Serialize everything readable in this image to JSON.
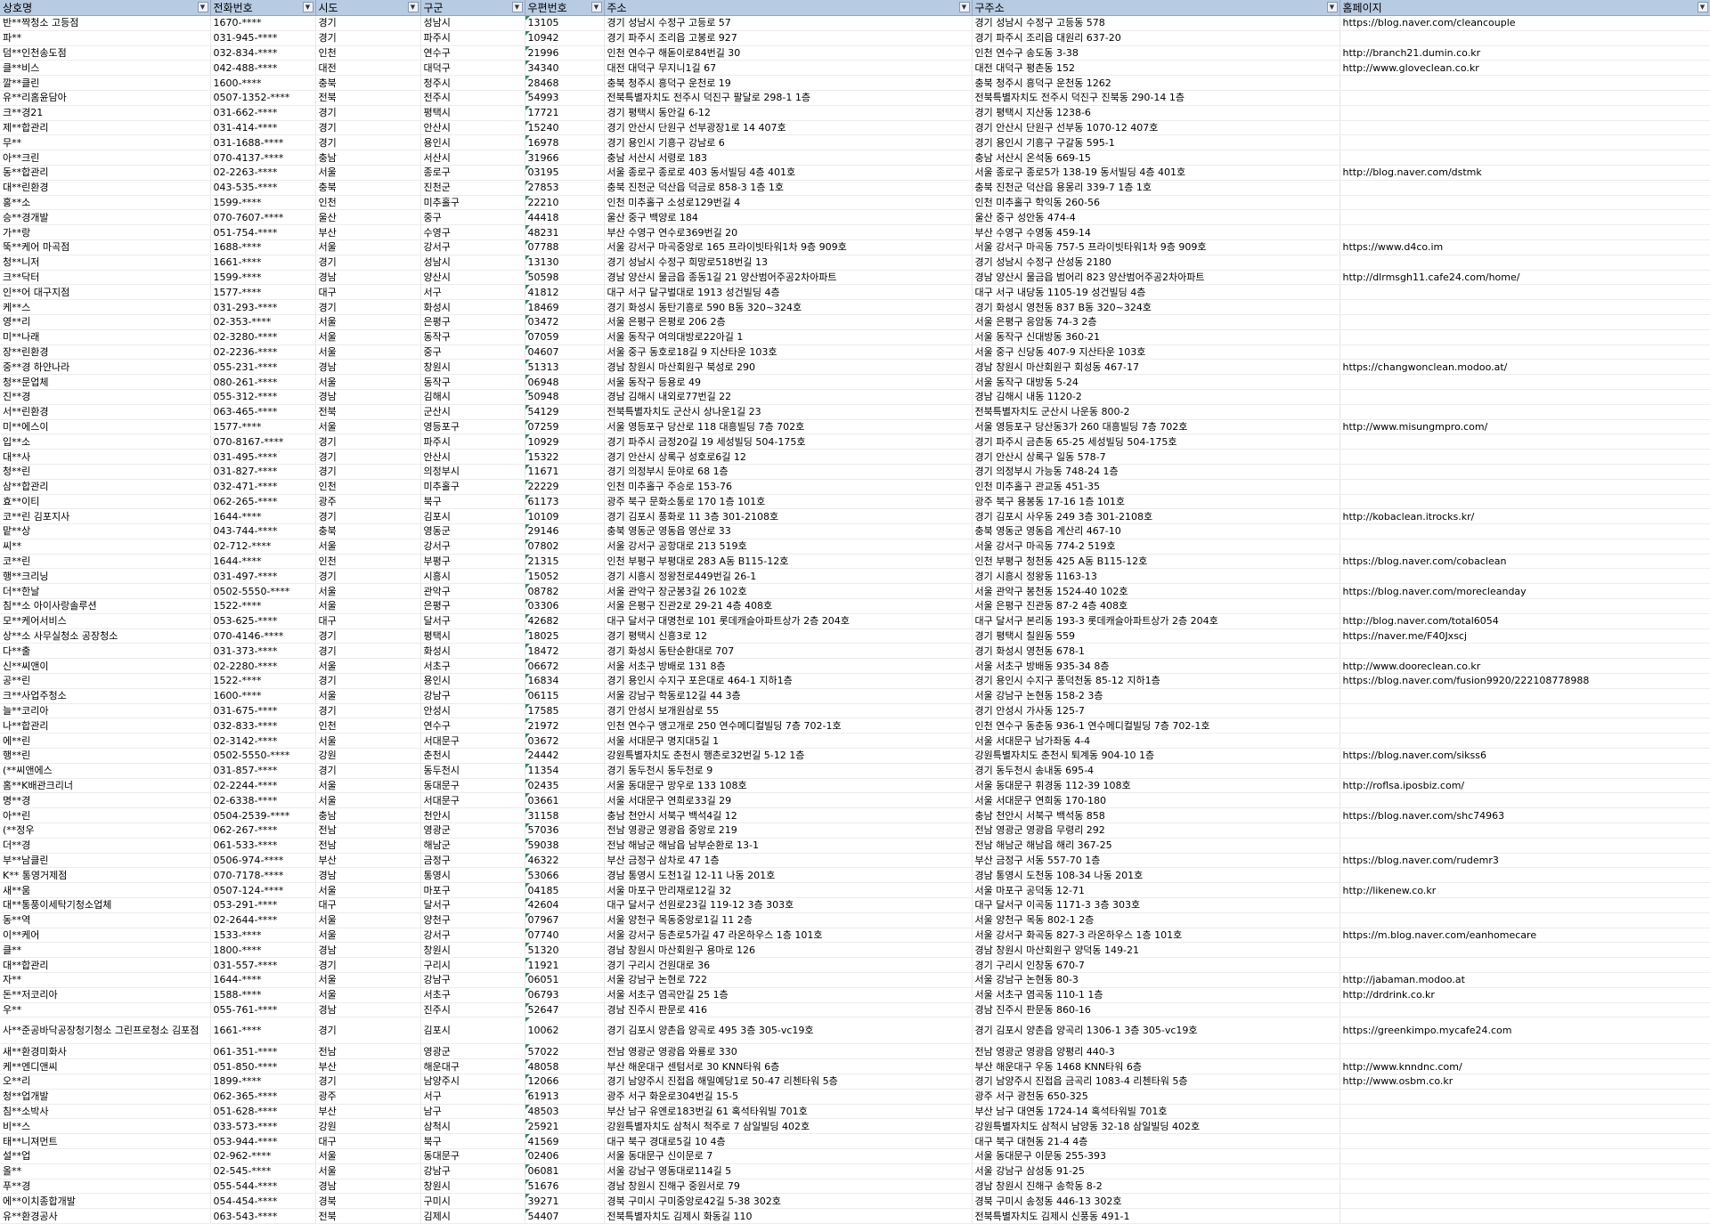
{
  "sheet": {
    "headers": [
      "상호명",
      "전화번호",
      "시도",
      "구군",
      "우편번호",
      "주소",
      "구주소",
      "홈페이지"
    ],
    "rows": [
      [
        "반**짝청소 고등점",
        "1670-****",
        "경기",
        "성남시",
        "13105",
        "경기 성남시 수정구 고등로 57",
        "경기 성남시 수정구 고등동 578",
        "https://blog.naver.com/cleancouple"
      ],
      [
        "파**",
        "031-945-****",
        "경기",
        "파주시",
        "10942",
        "경기 파주시 조리읍 고봉로 927",
        "경기 파주시 조리읍 대원리 637-20",
        ""
      ],
      [
        "덤**인천송도점",
        "032-834-****",
        "인천",
        "연수구",
        "21996",
        "인천 연수구 해돋이로84번길 30",
        "인천 연수구 송도동 3-38",
        "http://branch21.dumin.co.kr"
      ],
      [
        "클**비스",
        "042-488-****",
        "대전",
        "대덕구",
        "34340",
        "대전 대덕구 무지니1길 67",
        "대전 대덕구 평촌동 152",
        "http://www.gloveclean.co.kr"
      ],
      [
        "깔**클린",
        "1600-****",
        "충북",
        "청주시",
        "28468",
        "충북 청주시 흥덕구 운천로 19",
        "충북 청주시 흥덕구 운천동 1262",
        ""
      ],
      [
        "유**리홈윤담아",
        "0507-1352-****",
        "전북",
        "전주시",
        "54993",
        "전북특별자치도 전주시 덕진구 팔달로 298-1 1층",
        "전북특별자치도 전주시 덕진구 진북동 290-14 1층",
        ""
      ],
      [
        "크**경21",
        "031-662-****",
        "경기",
        "평택시",
        "17721",
        "경기 평택시 동안길 6-12",
        "경기 평택시 지산동 1238-6",
        ""
      ],
      [
        "제**합관리",
        "031-414-****",
        "경기",
        "안산시",
        "15240",
        "경기 안산시 단원구 선부광장1로 14 407호",
        "경기 안산시 단원구 선부동 1070-12 407호",
        ""
      ],
      [
        "무**",
        "031-1688-****",
        "경기",
        "용인시",
        "16978",
        "경기 용인시 기흥구 강남로 6",
        "경기 용인시 기흥구 구갈동 595-1",
        ""
      ],
      [
        "아**크린",
        "070-4137-****",
        "충남",
        "서산시",
        "31966",
        "충남 서산시 서령로 183",
        "충남 서산시 온석동 669-15",
        ""
      ],
      [
        "동**합관리",
        "02-2263-****",
        "서울",
        "종로구",
        "03195",
        "서울 종로구 종로로 403 동서빌딩 4층 401호",
        "서울 종로구 종로5가 138-19 동서빌딩 4층 401호",
        "http://blog.naver.com/dstmk"
      ],
      [
        "대**린환경",
        "043-535-****",
        "충북",
        "진천군",
        "27853",
        "충북 진천군 덕산읍 덕금로 858-3 1층 1호",
        "충북 진천군 덕산읍 용몽리 339-7 1층 1호",
        ""
      ],
      [
        "홍**소",
        "1599-****",
        "인천",
        "미추홀구",
        "22210",
        "인천 미추홀구 소성로129번길 4",
        "인천 미추홀구 학익동 260-56",
        ""
      ],
      [
        "승**경개발",
        "070-7607-****",
        "울산",
        "중구",
        "44418",
        "울산 중구 백양로 184",
        "울산 중구 성안동 474-4",
        ""
      ],
      [
        "가**랑",
        "051-754-****",
        "부산",
        "수영구",
        "48231",
        "부산 수영구 연수로369번길 20",
        "부산 수영구 수영동 459-14",
        ""
      ],
      [
        "뚝**케어 마곡점",
        "1688-****",
        "서울",
        "강서구",
        "07788",
        "서울 강서구 마곡중앙로 165 프라이빗타워1차 9층 909호",
        "서울 강서구 마곡동 757-5 프라이빗타워1차 9층 909호",
        "https://www.d4co.im"
      ],
      [
        "청**니저",
        "1661-****",
        "경기",
        "성남시",
        "13130",
        "경기 성남시 수정구 희망로518번길 13",
        "경기 성남시 수정구 산성동 2180",
        ""
      ],
      [
        "크**닥터",
        "1599-****",
        "경남",
        "양산시",
        "50598",
        "경남 양산시 물금읍 종동1길 21 양산범어주공2차아파트",
        "경남 양산시 물금읍 범어리 823 양산범어주공2차아파트",
        "http://dlrmsgh11.cafe24.com/home/"
      ],
      [
        "인**어 대구지점",
        "1577-****",
        "대구",
        "서구",
        "41812",
        "대구 서구 달구벌대로 1913 성건빌딩 4층",
        "대구 서구 내당동 1105-19 성건빌딩 4층",
        ""
      ],
      [
        "케**스",
        "031-293-****",
        "경기",
        "화성시",
        "18469",
        "경기 화성시 동탄기흥로 590 B동 320~324호",
        "경기 화성시 영천동 837 B동 320~324호",
        ""
      ],
      [
        "영**리",
        "02-353-****",
        "서울",
        "은평구",
        "03472",
        "서울 은평구 은평로 206 2층",
        "서울 은평구 응암동 74-3 2층",
        ""
      ],
      [
        "미**나래",
        "02-3280-****",
        "서울",
        "동작구",
        "07059",
        "서울 동작구 여의대방로22아길 1",
        "서울 동작구 신대방동 360-21",
        ""
      ],
      [
        "장**린환경",
        "02-2236-****",
        "서울",
        "중구",
        "04607",
        "서울 중구 동호로18길 9 지산타운 103호",
        "서울 중구 신당동 407-9 지산타운 103호",
        ""
      ],
      [
        "중**경 하얀나라",
        "055-231-****",
        "경남",
        "창원시",
        "51313",
        "경남 창원시 마산회원구 북성로 290",
        "경남 창원시 마산회원구 회성동 467-17",
        "https://changwonclean.modoo.at/"
      ],
      [
        "청**문업체",
        "080-261-****",
        "서울",
        "동작구",
        "06948",
        "서울 동작구 등용로 49",
        "서울 동작구 대방동 5-24",
        ""
      ],
      [
        "진**경",
        "055-312-****",
        "경남",
        "김해시",
        "50948",
        "경남 김해시 내외로77번길 22",
        "경남 김해시 내동 1120-2",
        ""
      ],
      [
        "서**린환경",
        "063-465-****",
        "전북",
        "군산시",
        "54129",
        "전북특별자치도 군산시 상나운1길 23",
        "전북특별자치도 군산시 나운동 800-2",
        ""
      ],
      [
        "미**에스이",
        "1577-****",
        "서울",
        "영등포구",
        "07259",
        "서울 영등포구 당산로 118 대흥빌딩 7층 702호",
        "서울 영등포구 당산동3가 260 대흥빌딩 7층 702호",
        "http://www.misungmpro.com/"
      ],
      [
        "입**소",
        "070-8167-****",
        "경기",
        "파주시",
        "10929",
        "경기 파주시 금정20길 19 세성빌딩 504-175호",
        "경기 파주시 금촌동 65-25 세성빌딩 504-175호",
        ""
      ],
      [
        "대**사",
        "031-495-****",
        "경기",
        "안산시",
        "15322",
        "경기 안산시 상록구 성호로6길 12",
        "경기 안산시 상록구 일동 578-7",
        ""
      ],
      [
        "청**린",
        "031-827-****",
        "경기",
        "의정부시",
        "11671",
        "경기 의정부시 둔야로 68 1층",
        "경기 의정부시 가능동 748-24 1층",
        ""
      ],
      [
        "삼**합관리",
        "032-471-****",
        "인천",
        "미추홀구",
        "22229",
        "인천 미추홀구 주승로 153-76",
        "인천 미추홀구 관교동 451-35",
        ""
      ],
      [
        "효**이티",
        "062-265-****",
        "광주",
        "북구",
        "61173",
        "광주 북구 문화소통로 170 1층 101호",
        "광주 북구 용봉동 17-16 1층 101호",
        ""
      ],
      [
        "코**린 김포지사",
        "1644-****",
        "경기",
        "김포시",
        "10109",
        "경기 김포시 풍화로 11 3층 301-2108호",
        "경기 김포시 사우동 249 3층 301-2108호",
        "http://kobaclean.itrocks.kr/"
      ],
      [
        "맡**상",
        "043-744-****",
        "충북",
        "영동군",
        "29146",
        "충북 영동군 영동읍 영산로 33",
        "충북 영동군 영동읍 계산리 467-10",
        ""
      ],
      [
        "씨**",
        "02-712-****",
        "서울",
        "강서구",
        "07802",
        "서울 강서구 공항대로 213 519호",
        "서울 강서구 마곡동 774-2 519호",
        ""
      ],
      [
        "코**린",
        "1644-****",
        "인천",
        "부평구",
        "21315",
        "인천 부평구 부평대로 283 A동 B115-12호",
        "인천 부평구 청천동 425 A동 B115-12호",
        "https://blog.naver.com/cobaclean"
      ],
      [
        "행**크리닝",
        "031-497-****",
        "경기",
        "시흥시",
        "15052",
        "경기 시흥시 정왕천로449번길 26-1",
        "경기 시흥시 정왕동 1163-13",
        ""
      ],
      [
        "더**한날",
        "0502-5550-****",
        "서울",
        "관악구",
        "08782",
        "서울 관악구 장군봉3길 26 102호",
        "서울 관악구 봉천동 1524-40 102호",
        "https://blog.naver.com/morecleanday"
      ],
      [
        "침**소 아이사랑솔루션",
        "1522-****",
        "서울",
        "은평구",
        "03306",
        "서울 은평구 진관2로 29-21 4층 408호",
        "서울 은평구 진관동 87-2 4층 408호",
        ""
      ],
      [
        "모**케어서비스",
        "053-625-****",
        "대구",
        "달서구",
        "42682",
        "대구 달서구 대명천로 101 롯데캐슬아파트상가 2층 204호",
        "대구 달서구 본리동 193-3 롯데캐슬아파트상가 2층 204호",
        "http://blog.naver.com/total6054"
      ],
      [
        "상**소 사무실청소 공장청소",
        "070-4146-****",
        "경기",
        "평택시",
        "18025",
        "경기 평택시 신흥3로 12",
        "경기 평택시 칠원동 559",
        "https://naver.me/F40Jxscj"
      ],
      [
        "다**출",
        "031-373-****",
        "경기",
        "화성시",
        "18472",
        "경기 화성시 동탄순환대로 707",
        "경기 화성시 영천동 678-1",
        ""
      ],
      [
        "신**씨앤이",
        "02-2280-****",
        "서울",
        "서초구",
        "06672",
        "서울 서초구 방배로 131 8층",
        "서울 서초구 방배동 935-34 8층",
        "http://www.dooreclean.co.kr"
      ],
      [
        "공**린",
        "1522-****",
        "경기",
        "용인시",
        "16834",
        "경기 용인시 수지구 포은대로 464-1 지하1층",
        "경기 용인시 수지구 풍덕천동 85-12 지하1층",
        "https://blog.naver.com/fusion9920/222108778988"
      ],
      [
        "크**사업주청소",
        "1600-****",
        "서울",
        "강남구",
        "06115",
        "서울 강남구 학동로12길 44 3층",
        "서울 강남구 논현동 158-2 3층",
        ""
      ],
      [
        "늘**코리아",
        "031-675-****",
        "경기",
        "안성시",
        "17585",
        "경기 안성시 보개원삼로 55",
        "경기 안성시 가사동 125-7",
        ""
      ],
      [
        "나**합관리",
        "032-833-****",
        "인천",
        "연수구",
        "21972",
        "인천 연수구 앵고개로 250 연수메디컬빌딩 7층 702-1호",
        "인천 연수구 동춘동 936-1 연수메디컬빌딩 7층 702-1호",
        ""
      ],
      [
        "에**린",
        "02-3142-****",
        "서울",
        "서대문구",
        "03672",
        "서울 서대문구 명지대5길 1",
        "서울 서대문구 남가좌동 4-4",
        ""
      ],
      [
        "행**린",
        "0502-5550-****",
        "강원",
        "춘천시",
        "24442",
        "강원특별자치도 춘천시 행촌로32번길 5-12 1층",
        "강원특별자치도 춘천시 퇴계동 904-10 1층",
        "https://blog.naver.com/sikss6"
      ],
      [
        "(**씨앤에스",
        "031-857-****",
        "경기",
        "동두천시",
        "11354",
        "경기 동두천시 동두천로 9",
        "경기 동두천시 송내동 695-4",
        ""
      ],
      [
        "홈**K배관크리너",
        "02-2244-****",
        "서울",
        "동대문구",
        "02435",
        "서울 동대문구 망우로 133 108호",
        "서울 동대문구 휘경동 112-39 108호",
        "http://roflsa.iposbiz.com/"
      ],
      [
        "명**경",
        "02-6338-****",
        "서울",
        "서대문구",
        "03661",
        "서울 서대문구 연희로33길 29",
        "서울 서대문구 연희동 170-180",
        ""
      ],
      [
        "아**린",
        "0504-2539-****",
        "충남",
        "천안시",
        "31158",
        "충남 천안시 서북구 백석4길 12",
        "충남 천안시 서북구 백석동 858",
        "https://blog.naver.com/shc74963"
      ],
      [
        "(**정우",
        "062-267-****",
        "전남",
        "영광군",
        "57036",
        "전남 영광군 영광읍 중앙로 219",
        "전남 영광군 영광읍 무령리 292",
        ""
      ],
      [
        "더**경",
        "061-533-****",
        "전남",
        "해남군",
        "59038",
        "전남 해남군 해남읍 남부순환로 13-1",
        "전남 해남군 해남읍 해리 367-25",
        ""
      ],
      [
        "부**남클린",
        "0506-974-****",
        "부산",
        "금정구",
        "46322",
        "부산 금정구 삼차로 47 1층",
        "부산 금정구 서동 557-70 1층",
        "https://blog.naver.com/rudemr3"
      ],
      [
        "K** 통영거제점",
        "070-7178-****",
        "경남",
        "통영시",
        "53066",
        "경남 통영시 도천1길 12-11 나동 201호",
        "경남 통영시 도천동 108-34 나동 201호",
        ""
      ],
      [
        "새**움",
        "0507-124-****",
        "서울",
        "마포구",
        "04185",
        "서울 마포구 만리재로12길 32",
        "서울 마포구 공덕동 12-71",
        "http://likenew.co.kr"
      ],
      [
        "대**통풍이세탁기청소업체",
        "053-291-****",
        "대구",
        "달서구",
        "42604",
        "대구 달서구 선원로23길 119-12 3층 303호",
        "대구 달서구 이곡동 1171-3 3층 303호",
        ""
      ],
      [
        "동**역",
        "02-2644-****",
        "서울",
        "양천구",
        "07967",
        "서울 양천구 목동중앙로1길 11 2층",
        "서울 양천구 목동 802-1 2층",
        ""
      ],
      [
        "이**케어",
        "1533-****",
        "서울",
        "강서구",
        "07740",
        "서울 강서구 등촌로5가길 47 라온하우스 1층 101호",
        "서울 강서구 화곡동 827-3 라온하우스 1층 101호",
        "https://m.blog.naver.com/eanhomecare"
      ],
      [
        "클**",
        "1800-****",
        "경남",
        "창원시",
        "51320",
        "경남 창원시 마산회원구 용마로 126",
        "경남 창원시 마산회원구 양덕동 149-21",
        ""
      ],
      [
        "대**합관리",
        "031-557-****",
        "경기",
        "구리시",
        "11921",
        "경기 구리시 건원대로 36",
        "경기 구리시 인창동 670-7",
        ""
      ],
      [
        "자**",
        "1644-****",
        "서울",
        "강남구",
        "06051",
        "서울 강남구 논현로 722",
        "서울 강남구 논현동 80-3",
        "http://jabaman.modoo.at"
      ],
      [
        "돈**저코리아",
        "1588-****",
        "서울",
        "서초구",
        "06793",
        "서울 서초구 염곡안길 25 1층",
        "서울 서초구 염곡동 110-1 1층",
        "http://drdrink.co.kr"
      ],
      [
        "우**",
        "055-761-****",
        "경남",
        "진주시",
        "52647",
        "경남 진주시 판문로 416",
        "경남 진주시 판문동 860-16",
        ""
      ],
      [
        "사**준공바닥공장청기청소 그린프로청소 김포점",
        "1661-****",
        "경기",
        "김포시",
        "10062",
        "경기 김포시 양촌읍 양곡로 495 3층 305-vc19호",
        "경기 김포시 양촌읍 양곡리 1306-1 3층 305-vc19호",
        "https://greenkimpo.mycafe24.com"
      ],
      [
        "새**환경미화사",
        "061-351-****",
        "전남",
        "영광군",
        "57022",
        "전남 영광군 영광읍 와룡로 330",
        "전남 영광군 영광읍 양평리 440-3",
        ""
      ],
      [
        "케**엔디앤씨",
        "051-850-****",
        "부산",
        "해운대구",
        "48058",
        "부산 해운대구 센텀서로 30 KNN타워 6층",
        "부산 해운대구 우동 1468 KNN타워 6층",
        "http://www.knndnc.com/"
      ],
      [
        "오**리",
        "1899-****",
        "경기",
        "남양주시",
        "12066",
        "경기 남양주시 진접읍 해밀예당1로 50-47 리첸타워 5층",
        "경기 남양주시 진접읍 금곡리 1083-4 리첸타워 5층",
        "http://www.osbm.co.kr"
      ],
      [
        "청**업개발",
        "062-365-****",
        "광주",
        "서구",
        "61913",
        "광주 서구 화운로304번길 15-5",
        "광주 서구 광천동 650-325",
        ""
      ],
      [
        "침**소박사",
        "051-628-****",
        "부산",
        "남구",
        "48503",
        "부산 남구 유엔로183번길 61 혹석타워빌 701호",
        "부산 남구 대연동 1724-14 혹석타워빌 701호",
        ""
      ],
      [
        "비**스",
        "033-573-****",
        "강원",
        "삼척시",
        "25921",
        "강원특별자치도 삼척시 척주로 7 삼일빌딩 402호",
        "강원특별자치도 삼척시 남양동 32-18 삼일빌딩 402호",
        ""
      ],
      [
        "태**니져먼트",
        "053-944-****",
        "대구",
        "북구",
        "41569",
        "대구 북구 경대로5길 10 4층",
        "대구 북구 대현동 21-4 4층",
        ""
      ],
      [
        "설**업",
        "02-962-****",
        "서울",
        "동대문구",
        "02406",
        "서울 동대문구 신이문로 7",
        "서울 동대문구 이문동 255-393",
        ""
      ],
      [
        "올**",
        "02-545-****",
        "서울",
        "강남구",
        "06081",
        "서울 강남구 영동대로114길 5",
        "서울 강남구 삼성동 91-25",
        ""
      ],
      [
        "푸**경",
        "055-544-****",
        "경남",
        "창원시",
        "51676",
        "경남 창원시 진해구 중원서로 79",
        "경남 창원시 진해구 송학동 8-2",
        ""
      ],
      [
        "에**이치종합개발",
        "054-454-****",
        "경북",
        "구미시",
        "39271",
        "경북 구미시 구미중앙로42길 5-38 302호",
        "경북 구미시 송정동 446-13 302호",
        ""
      ],
      [
        "유**환경공사",
        "063-543-****",
        "전북",
        "김제시",
        "54407",
        "전북특별자치도 김제시 화동길 110",
        "전북특별자치도 김제시 신풍동 491-1",
        ""
      ]
    ]
  }
}
